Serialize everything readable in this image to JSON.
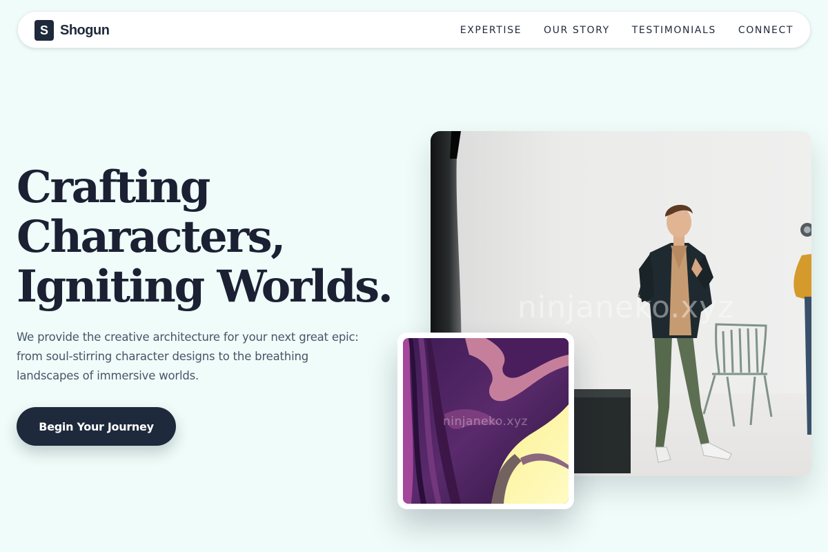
{
  "brand": {
    "logo_letter": "S",
    "name": "Shogun"
  },
  "nav": {
    "links": [
      {
        "label": "EXPERTISE"
      },
      {
        "label": "OUR STORY"
      },
      {
        "label": "TESTIMONIALS"
      },
      {
        "label": "CONNECT"
      }
    ]
  },
  "hero": {
    "title_lines": [
      "Crafting",
      "Characters,",
      "Igniting Worlds."
    ],
    "description": "We provide the creative architecture for your next great epic: from soul-stirring character designs to the breathing landscapes of immersive worlds.",
    "cta_label": "Begin Your Journey"
  },
  "media": {
    "main_photo_watermark": "ninjaneko.xyz",
    "card_watermark": "ninjaneko.xyz"
  },
  "colors": {
    "background": "#effcf9",
    "primary_dark": "#1e293b",
    "body_text": "#475569",
    "card_purple": "#4a1d5c",
    "card_yellow": "#fbf4a0"
  }
}
